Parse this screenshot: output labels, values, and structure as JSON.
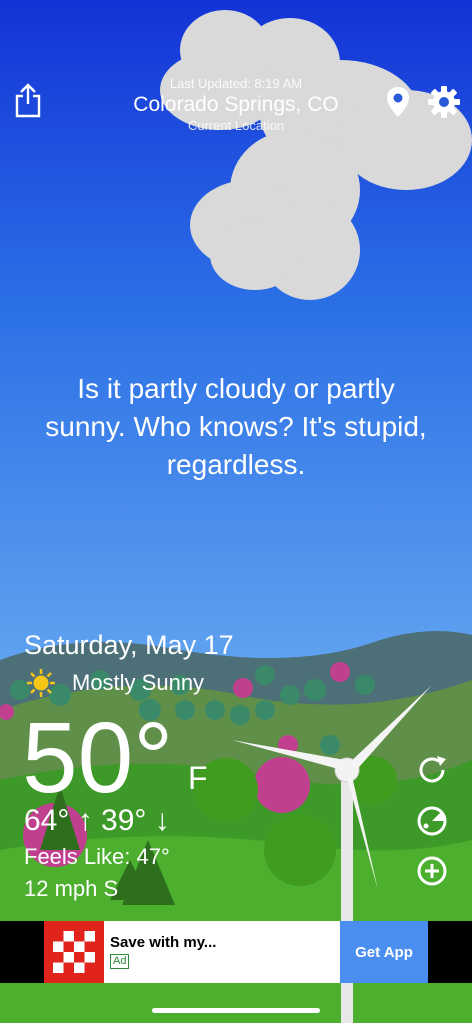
{
  "header": {
    "last_updated": "Last Updated: 8:19 AM",
    "city": "Colorado Springs, CO",
    "location_label": "Current Location"
  },
  "icons": {
    "share": "share-icon",
    "location": "location-pin-icon",
    "settings": "gear-icon",
    "refresh": "refresh-icon",
    "radar": "radar-icon",
    "add": "add-location-icon",
    "condition": "sun-icon"
  },
  "quote": "Is it partly cloudy or partly sunny. Who knows? It's stupid, regardless.",
  "weather": {
    "date": "Saturday, May 17",
    "condition": "Mostly Sunny",
    "temperature": "50°",
    "unit": "F",
    "hilo": "64° ↑ 39° ↓",
    "feels_like": "Feels Like: 47°",
    "wind": "12 mph S"
  },
  "ad": {
    "title": "Save with my...",
    "badge": "Ad",
    "cta": "Get App"
  },
  "colors": {
    "sky_top": "#1433d6",
    "sky_bottom": "#5fa2f0",
    "grass": "#3e9a28",
    "ad_button": "#4a8ff0",
    "ad_logo": "#e0241c"
  }
}
